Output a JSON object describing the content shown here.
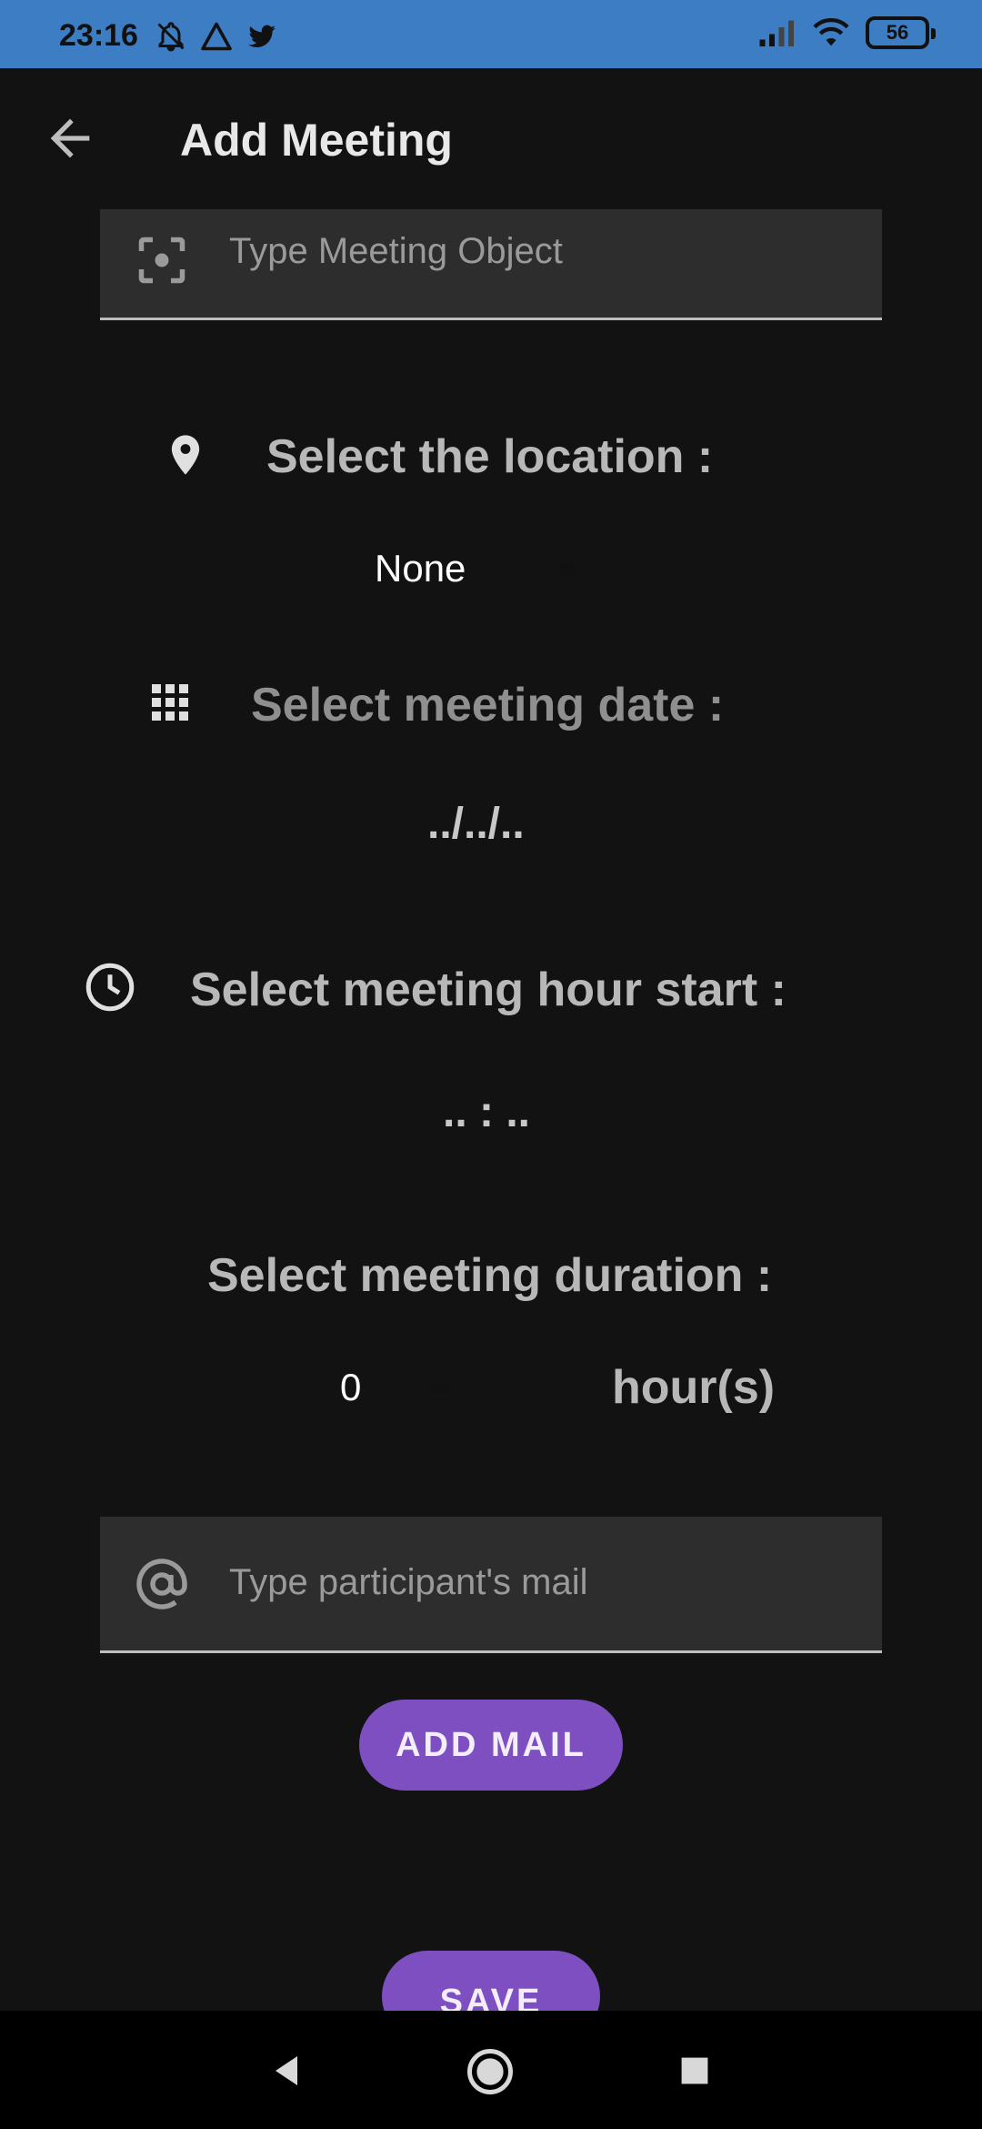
{
  "status_bar": {
    "time": "23:16",
    "battery": "56"
  },
  "app_bar": {
    "title": "Add Meeting"
  },
  "object_field": {
    "placeholder": "Type Meeting Object"
  },
  "location": {
    "label": "Select the location :",
    "selected": "None"
  },
  "date": {
    "label": "Select meeting date :",
    "value": "../../.."
  },
  "hour_start": {
    "label": "Select meeting hour start :",
    "value": ".. : .."
  },
  "duration": {
    "label": "Select meeting duration :",
    "selected": "0",
    "unit": "hour(s)"
  },
  "mail_field": {
    "placeholder": "Type participant's mail"
  },
  "buttons": {
    "add_mail": "ADD MAIL",
    "save": "SAVE"
  },
  "colors": {
    "status_bar": "#3d7dc4",
    "background": "#121212",
    "accent": "#7e4fc1"
  }
}
